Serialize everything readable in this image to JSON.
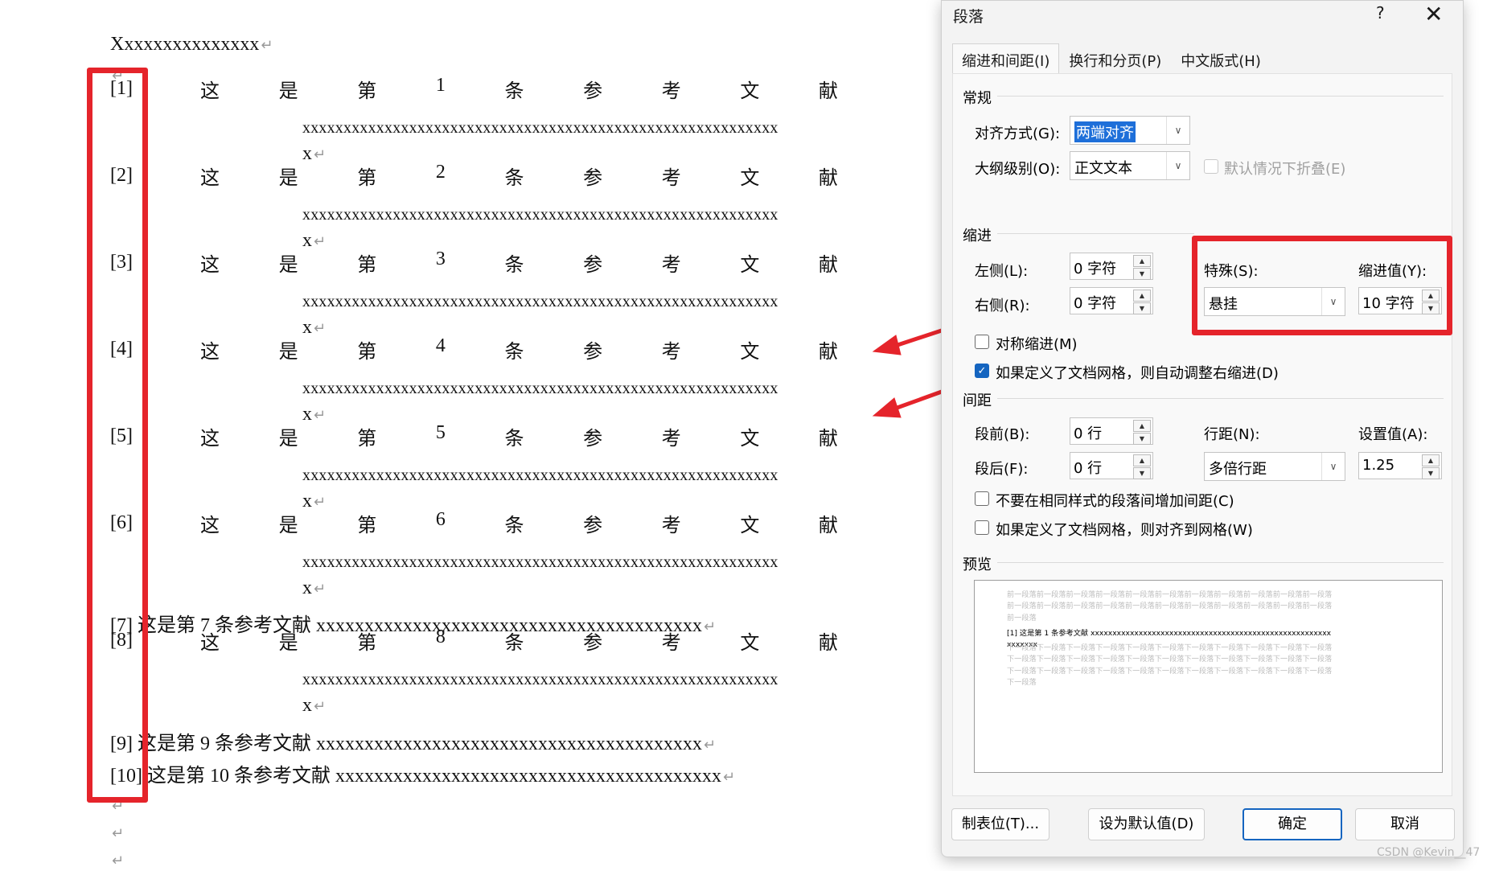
{
  "document": {
    "heading": "Xxxxxxxxxxxxxxx",
    "return_mark": "↵",
    "refs": [
      {
        "num": "[1]",
        "words": [
          "这",
          "是",
          "第",
          "1",
          "条",
          "参",
          "考",
          "文",
          "献"
        ],
        "cont": "xxxxxxxxxxxxxxxxxxxxxxxxxxxxxxxxxxxxxxxxxxxxxxxxxxxxxxxxxx",
        "last": "x"
      },
      {
        "num": "[2]",
        "words": [
          "这",
          "是",
          "第",
          "2",
          "条",
          "参",
          "考",
          "文",
          "献"
        ],
        "cont": "xxxxxxxxxxxxxxxxxxxxxxxxxxxxxxxxxxxxxxxxxxxxxxxxxxxxxxxxxx",
        "last": "x"
      },
      {
        "num": "[3]",
        "words": [
          "这",
          "是",
          "第",
          "3",
          "条",
          "参",
          "考",
          "文",
          "献"
        ],
        "cont": "xxxxxxxxxxxxxxxxxxxxxxxxxxxxxxxxxxxxxxxxxxxxxxxxxxxxxxxxxx",
        "last": "x"
      },
      {
        "num": "[4]",
        "words": [
          "这",
          "是",
          "第",
          "4",
          "条",
          "参",
          "考",
          "文",
          "献"
        ],
        "cont": "xxxxxxxxxxxxxxxxxxxxxxxxxxxxxxxxxxxxxxxxxxxxxxxxxxxxxxxxxx",
        "last": "x"
      },
      {
        "num": "[5]",
        "words": [
          "这",
          "是",
          "第",
          "5",
          "条",
          "参",
          "考",
          "文",
          "献"
        ],
        "cont": "xxxxxxxxxxxxxxxxxxxxxxxxxxxxxxxxxxxxxxxxxxxxxxxxxxxxxxxxxx",
        "last": "x"
      },
      {
        "num": "[6]",
        "words": [
          "这",
          "是",
          "第",
          "6",
          "条",
          "参",
          "考",
          "文",
          "献"
        ],
        "cont": "xxxxxxxxxxxxxxxxxxxxxxxxxxxxxxxxxxxxxxxxxxxxxxxxxxxxxxxxxx",
        "last": "x"
      },
      {
        "num": "[8]",
        "words": [
          "这",
          "是",
          "第",
          "8",
          "条",
          "参",
          "考",
          "文",
          "献"
        ],
        "cont": "xxxxxxxxxxxxxxxxxxxxxxxxxxxxxxxxxxxxxxxxxxxxxxxxxxxxxxxxxx",
        "last": "x"
      }
    ],
    "ref7": "[7]  这是第 7 条参考文献 xxxxxxxxxxxxxxxxxxxxxxxxxxxxxxxxxxxxxxxx",
    "ref9": "[9]  这是第 9 条参考文献 xxxxxxxxxxxxxxxxxxxxxxxxxxxxxxxxxxxxxxxx",
    "ref10": "[10]  这是第 10 条参考文献 xxxxxxxxxxxxxxxxxxxxxxxxxxxxxxxxxxxxxxxx"
  },
  "dialog": {
    "title": "段落",
    "help": "?",
    "close": "✕",
    "tabs": [
      "缩进和间距(I)",
      "换行和分页(P)",
      "中文版式(H)"
    ],
    "general": {
      "section": "常规",
      "align_label": "对齐方式(G):",
      "align_value": "两端对齐",
      "outline_label": "大纲级别(O):",
      "outline_value": "正文文本",
      "collapse_label": "默认情况下折叠(E)"
    },
    "indent": {
      "section": "缩进",
      "left_label": "左侧(L):",
      "left_value": "0 字符",
      "right_label": "右侧(R):",
      "right_value": "0 字符",
      "special_label": "特殊(S):",
      "special_value": "悬挂",
      "by_label": "缩进值(Y):",
      "by_value": "10 字符",
      "mirror_label": "对称缩进(M)",
      "auto_label": "如果定义了文档网格，则自动调整右缩进(D)"
    },
    "spacing": {
      "section": "间距",
      "before_label": "段前(B):",
      "before_value": "0 行",
      "after_label": "段后(F):",
      "after_value": "0 行",
      "line_label": "行距(N):",
      "line_value": "多倍行距",
      "at_label": "设置值(A):",
      "at_value": "1.25",
      "nospace_label": "不要在相同样式的段落间增加间距(C)",
      "snap_label": "如果定义了文档网格，则对齐到网格(W)"
    },
    "preview": {
      "section": "预览",
      "prev_text": "前一段落前一段落前一段落前一段落前一段落前一段落前一段落前一段落前一段落前一段落前一段落前一段落前一段落前一段落前一段落前一段落前一段落前一段落前一段落前一段落前一段落前一段落前一段落",
      "current_text": "[1]  这是第 1 条参考文献 xxxxxxxxxxxxxxxxxxxxxxxxxxxxxxxxxxxxxxxxxxxxxxxxxxxxxxxxxxxxxx",
      "next_text": "下一段落下一段落下一段落下一段落下一段落下一段落下一段落下一段落下一段落下一段落下一段落下一段落下一段落下一段落下一段落下一段落下一段落下一段落下一段落下一段落下一段落下一段落下一段落下一段落下一段落下一段落下一段落下一段落下一段落下一段落下一段落下一段落下一段落下一段落"
    },
    "buttons": {
      "tabs": "制表位(T)...",
      "default": "设为默认值(D)",
      "ok": "确定",
      "cancel": "取消"
    }
  },
  "watermark": "CSDN @Kevin__47",
  "colors": {
    "annotation_red": "#e5242b",
    "accent_blue": "#1565c0"
  }
}
